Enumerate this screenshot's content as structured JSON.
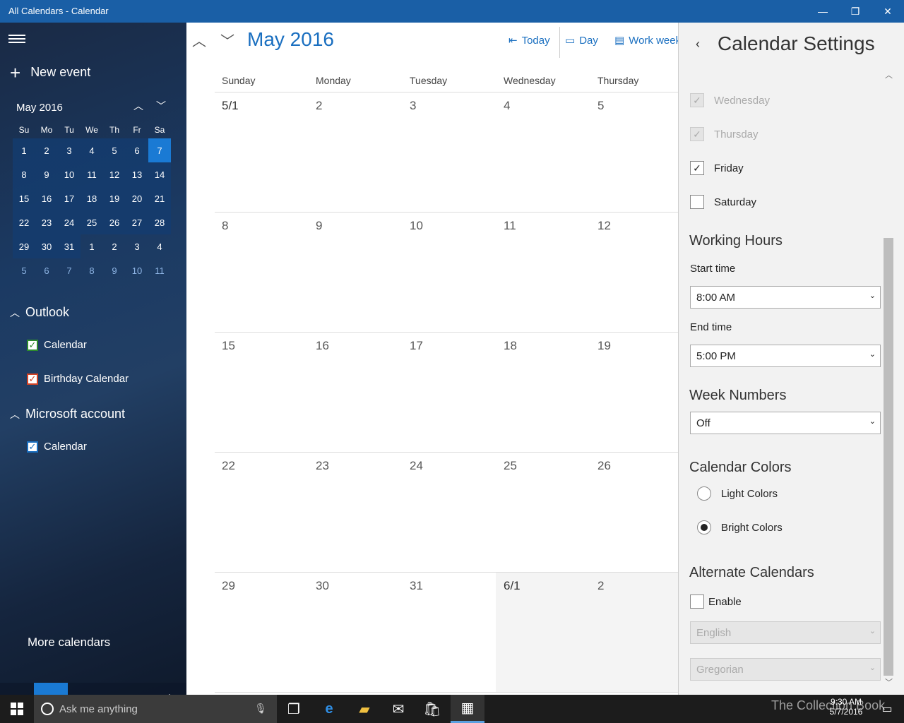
{
  "window": {
    "title": "All Calendars - Calendar",
    "minimize": "—",
    "restore": "❐",
    "close": "✕"
  },
  "sidebar": {
    "new_event": "New event",
    "mini_calendar": {
      "month_label": "May 2016",
      "days_of_week": [
        "Su",
        "Mo",
        "Tu",
        "We",
        "Th",
        "Fr",
        "Sa"
      ],
      "weeks": [
        [
          "1",
          "2",
          "3",
          "4",
          "5",
          "6",
          "7"
        ],
        [
          "8",
          "9",
          "10",
          "11",
          "12",
          "13",
          "14"
        ],
        [
          "15",
          "16",
          "17",
          "18",
          "19",
          "20",
          "21"
        ],
        [
          "22",
          "23",
          "24",
          "25",
          "26",
          "27",
          "28"
        ],
        [
          "29",
          "30",
          "31",
          "1",
          "2",
          "3",
          "4"
        ],
        [
          "5",
          "6",
          "7",
          "8",
          "9",
          "10",
          "11"
        ]
      ],
      "selected_day": "7"
    },
    "groups": [
      {
        "name": "Outlook",
        "calendars": [
          {
            "label": "Calendar",
            "color": "#2e8b2e",
            "checked": true
          },
          {
            "label": "Birthday Calendar",
            "color": "#d14124",
            "checked": true
          }
        ]
      },
      {
        "name": "Microsoft account",
        "calendars": [
          {
            "label": "Calendar",
            "color": "#1a6fc0",
            "checked": true
          }
        ]
      }
    ],
    "more_calendars": "More calendars"
  },
  "toolbar": {
    "month_title": "May 2016",
    "today": "Today",
    "day": "Day",
    "work_week": "Work week"
  },
  "month_grid": {
    "day_headers": [
      "Sunday",
      "Monday",
      "Tuesday",
      "Wednesday",
      "Thursday"
    ],
    "weeks": [
      [
        "5/1",
        "2",
        "3",
        "4",
        "5"
      ],
      [
        "8",
        "9",
        "10",
        "11",
        "12"
      ],
      [
        "15",
        "16",
        "17",
        "18",
        "19"
      ],
      [
        "22",
        "23",
        "24",
        "25",
        "26"
      ],
      [
        "29",
        "30",
        "31",
        "6/1",
        "2"
      ]
    ]
  },
  "settings": {
    "title": "Calendar Settings",
    "days": [
      {
        "label": "Wednesday",
        "checked": true,
        "disabled": true
      },
      {
        "label": "Thursday",
        "checked": true,
        "disabled": true
      },
      {
        "label": "Friday",
        "checked": true,
        "disabled": false
      },
      {
        "label": "Saturday",
        "checked": false,
        "disabled": false
      }
    ],
    "working_hours": {
      "heading": "Working Hours",
      "start_label": "Start time",
      "start_value": "8:00 AM",
      "end_label": "End time",
      "end_value": "5:00 PM"
    },
    "week_numbers": {
      "heading": "Week Numbers",
      "value": "Off"
    },
    "calendar_colors": {
      "heading": "Calendar Colors",
      "light": "Light Colors",
      "bright": "Bright Colors",
      "selected": "bright"
    },
    "alternate_calendars": {
      "heading": "Alternate Calendars",
      "enable_label": "Enable",
      "enabled": false,
      "language": "English",
      "calendar_type": "Gregorian"
    }
  },
  "taskbar": {
    "search_placeholder": "Ask me anything",
    "time": "9:30 AM",
    "date": "5/7/2016",
    "watermark": "The Collection Book"
  },
  "colors": {
    "titlebar": "#1a5fa6",
    "accent": "#1a6fc0",
    "selected_day": "#1a7ad4"
  }
}
